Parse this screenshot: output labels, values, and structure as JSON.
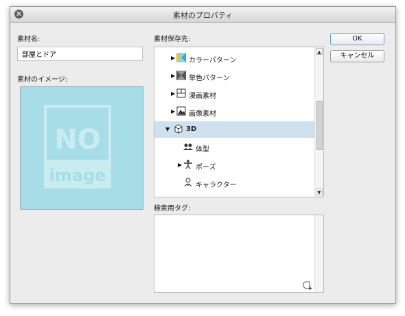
{
  "window": {
    "title": "素材のプロパティ"
  },
  "left": {
    "name_label": "素材名:",
    "name_value": "部屋とドア",
    "image_label": "素材のイメージ:",
    "placeholder_top": "NO",
    "placeholder_bottom": "image"
  },
  "tree": {
    "label": "素材保存先:",
    "items": [
      {
        "label": "カラーパターン",
        "icon": "color-pattern-icon"
      },
      {
        "label": "単色パターン",
        "icon": "mono-pattern-icon"
      },
      {
        "label": "漫画素材",
        "icon": "manga-icon"
      },
      {
        "label": "画像素材",
        "icon": "image-icon"
      },
      {
        "label": "3D",
        "icon": "cube-icon",
        "selected": true
      },
      {
        "label": "体型",
        "icon": "people-icon"
      },
      {
        "label": "ポーズ",
        "icon": "pose-icon"
      },
      {
        "label": "キャラクター",
        "icon": "character-icon"
      }
    ]
  },
  "tags": {
    "label": "検索用タグ:"
  },
  "buttons": {
    "ok": "OK",
    "cancel": "キャンセル"
  }
}
